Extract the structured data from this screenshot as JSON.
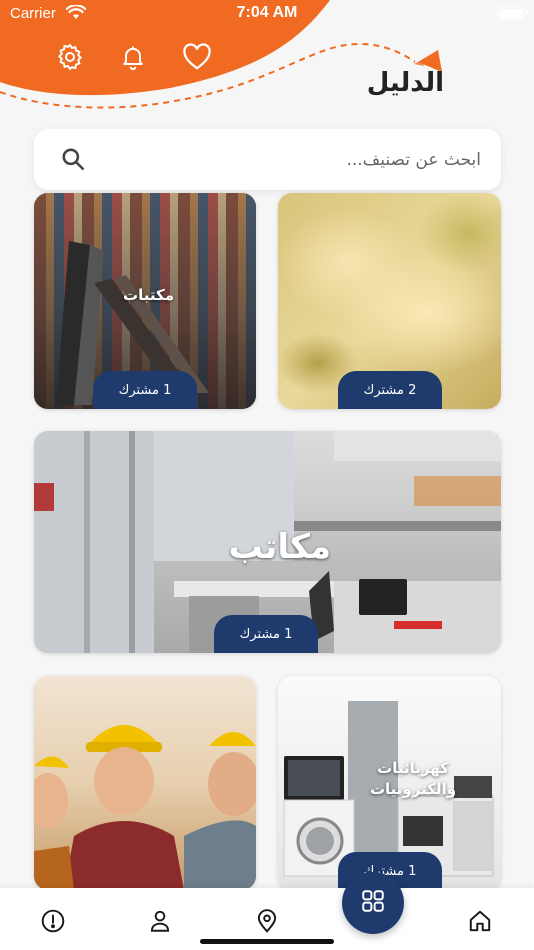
{
  "status_bar": {
    "carrier": "Carrier",
    "time": "7:04 AM"
  },
  "header": {
    "brand": "الدليل",
    "accent": "#f16a22"
  },
  "search": {
    "placeholder": "ابحث عن تصنيف..."
  },
  "categories": [
    {
      "title": "",
      "subscribers": "2 مشترك"
    },
    {
      "title": "مكتبات",
      "subscribers": "1 مشترك"
    },
    {
      "title": "مكاتب",
      "subscribers": "1 مشترك"
    },
    {
      "title": "كهربائيات والكترونيات",
      "subscribers": "1 مشترك"
    },
    {
      "title": "",
      "subscribers": ""
    }
  ],
  "bottom_nav": {
    "items": [
      "home-icon",
      "grid-icon",
      "location-pin-icon",
      "profile-icon",
      "info-icon"
    ],
    "active_color": "#1f3b6e"
  }
}
